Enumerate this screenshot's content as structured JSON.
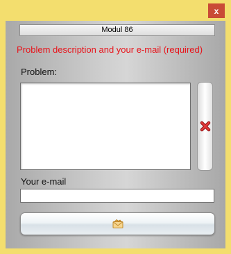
{
  "window": {
    "close_glyph": "x"
  },
  "module": {
    "title": "Modul 86"
  },
  "form": {
    "description": "Problem description and your e-mail (required)",
    "problem_label": "Problem:",
    "problem_value": "",
    "email_label": "Your e-mail",
    "email_value": ""
  },
  "icons": {
    "clear": "red-x-icon",
    "send": "envelope-icon"
  },
  "colors": {
    "frame": "#f3de6e",
    "close": "#c94b36",
    "accent_text": "#e8131a"
  }
}
